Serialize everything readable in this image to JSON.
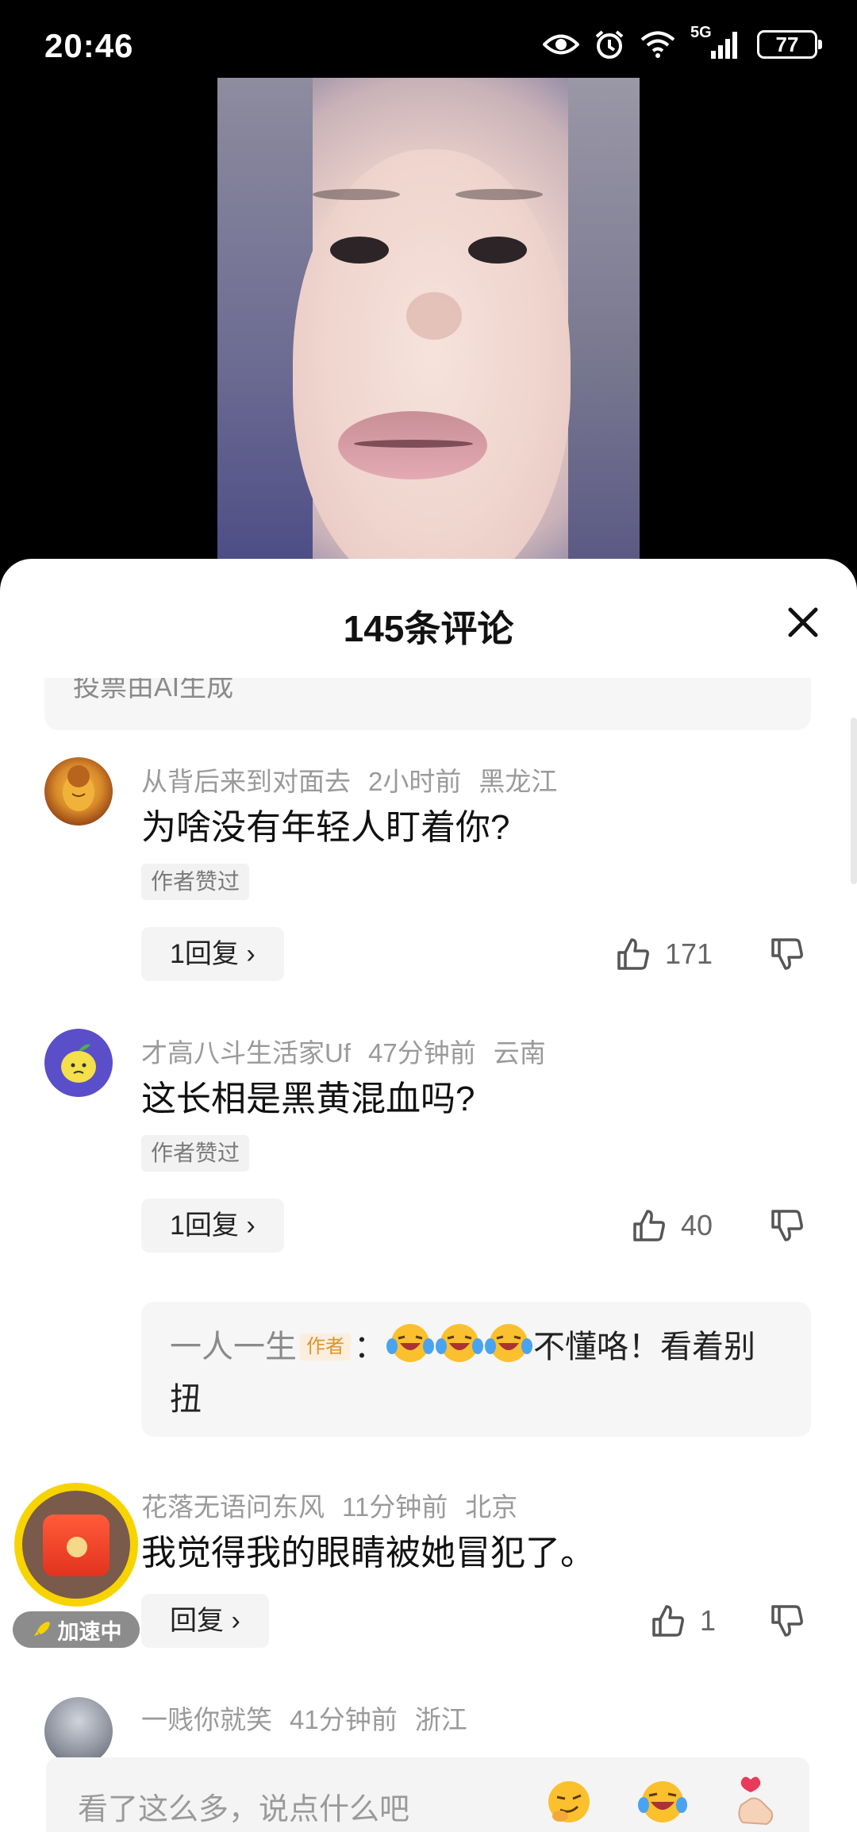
{
  "status_bar": {
    "time": "20:46",
    "battery": "77",
    "network": "5G"
  },
  "comments_panel": {
    "title": "145条评论",
    "ai_note_partial": "投票由AI生成",
    "comments": [
      {
        "username": "从背后来到对面去",
        "time": "2小时前",
        "location": "黑龙江",
        "text": "为啥没有年轻人盯着你?",
        "tag": "作者赞过",
        "reply_label": "1回复 ›",
        "likes": "171"
      },
      {
        "username": "才高八斗生活家Uf",
        "time": "47分钟前",
        "location": "云南",
        "text": "这长相是黑黄混血吗?",
        "tag": "作者赞过",
        "reply_label": "1回复 ›",
        "likes": "40",
        "sub_reply": {
          "name": "一人一生",
          "author_tag": "作者",
          "separator": "：",
          "text": "不懂咯！看着别扭"
        }
      },
      {
        "username": "花落无语问东风",
        "time": "11分钟前",
        "location": "北京",
        "text": "我觉得我的眼睛被她冒犯了。",
        "reply_label": "回复 ›",
        "likes": "1"
      },
      {
        "username": "一贱你就笑",
        "time": "41分钟前",
        "location": "浙江"
      }
    ]
  },
  "float_badge": {
    "label": "加速中"
  },
  "input": {
    "placeholder": "看了这么多，说点什么吧"
  },
  "colors": {
    "accent_tag": "#d9962e",
    "float_ring": "#f7d400",
    "envelope": "#e2331e"
  }
}
